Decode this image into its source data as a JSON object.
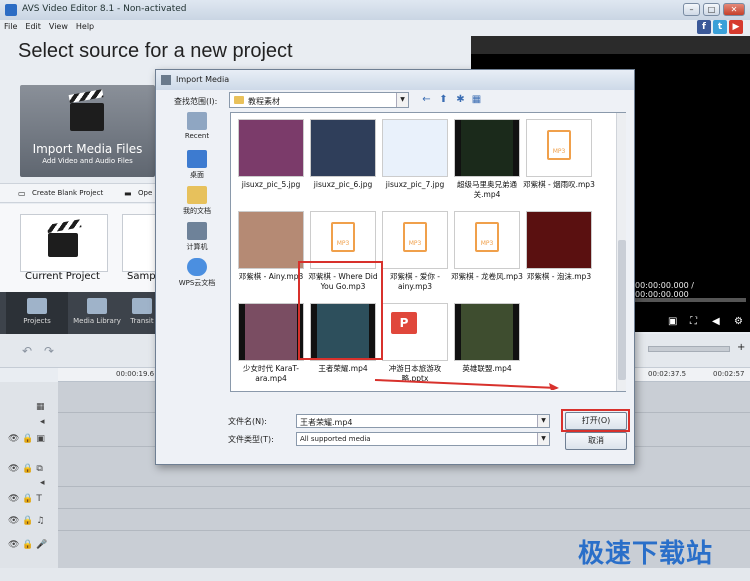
{
  "window": {
    "title": "AVS Video Editor 8.1 - Non-activated"
  },
  "menu": [
    "File",
    "Edit",
    "View",
    "Help"
  ],
  "social": [
    {
      "icon": "facebook-icon",
      "glyph": "f",
      "color": "#3b5998"
    },
    {
      "icon": "twitter-icon",
      "glyph": "t",
      "color": "#3aa0d8"
    },
    {
      "icon": "youtube-icon",
      "glyph": "▶",
      "color": "#d63a2e"
    }
  ],
  "main": {
    "heading": "Select source for a new project",
    "import_tile": {
      "title": "Import Media Files",
      "subtitle": "Add Video and Audio Files"
    },
    "create_blank": "Create Blank Project",
    "open_partial": "Ope",
    "tiles": [
      "Current Project",
      "Samp"
    ]
  },
  "nav": [
    "Projects",
    "Media Library",
    "Transit"
  ],
  "preview": {
    "time": "00:00:00.000 / 00:00:00.000"
  },
  "ruler": [
    "00:00:19.6",
    "00:02:37.5",
    "00:02:57"
  ],
  "watermark": "极速下载站",
  "dialog": {
    "title": "Import Media",
    "look_in_label": "查找范围(I):",
    "look_in_value": "教程素材",
    "places": [
      {
        "label": "Recent",
        "icon": "recent-icon",
        "color": "#8fa6c2"
      },
      {
        "label": "桌面",
        "icon": "desktop-icon",
        "color": "#3d7bd0"
      },
      {
        "label": "我的文档",
        "icon": "documents-icon",
        "color": "#e7c15c"
      },
      {
        "label": "计算机",
        "icon": "computer-icon",
        "color": "#6e8299"
      },
      {
        "label": "WPS云文档",
        "icon": "cloud-icon",
        "color": "#4b8fe0"
      }
    ],
    "files": [
      {
        "name": "jisuxz_pic_5.jpg",
        "kind": "image",
        "color": "#7b3b6a"
      },
      {
        "name": "jisuxz_pic_6.jpg",
        "kind": "image",
        "color": "#2f3e5a"
      },
      {
        "name": "jisuxz_pic_7.jpg",
        "kind": "image",
        "color": "#e9f1fb"
      },
      {
        "name": "超级马里奥兄弟通关.mp4",
        "kind": "video",
        "color": "#1b2a1b"
      },
      {
        "name": "邓紫棋 - 烟雨叹.mp3",
        "kind": "mp3",
        "color": "#ffffff"
      },
      {
        "name": "邓紫棋 - Ainy.mp3",
        "kind": "photo",
        "color": "#b58a74"
      },
      {
        "name": "邓紫棋 - Where Did You Go.mp3",
        "kind": "mp3",
        "color": "#ffffff"
      },
      {
        "name": "邓紫棋 - 爱你 - ainy.mp3",
        "kind": "mp3",
        "color": "#ffffff"
      },
      {
        "name": "邓紫棋 - 龙卷风.mp3",
        "kind": "mp3",
        "color": "#ffffff"
      },
      {
        "name": "邓紫棋 - 泡沫.mp3",
        "kind": "photo",
        "color": "#5a1010"
      },
      {
        "name": "少女时代 KaraT-ara.mp4",
        "kind": "video",
        "color": "#7a4d62"
      },
      {
        "name": "王者荣耀.mp4",
        "kind": "video",
        "color": "#2d4f5c"
      },
      {
        "name": "冲游日本旅游攻略.pptx",
        "kind": "pptx",
        "color": "#ffffff"
      },
      {
        "name": "英雄联盟.mp4",
        "kind": "video",
        "color": "#3e4d2f"
      }
    ],
    "file_name_label": "文件名(N):",
    "file_name_value": "王者荣耀.mp4",
    "file_type_label": "文件类型(T):",
    "file_type_value": "All supported media",
    "open_button": "打开(O)",
    "cancel_button": "取消"
  }
}
